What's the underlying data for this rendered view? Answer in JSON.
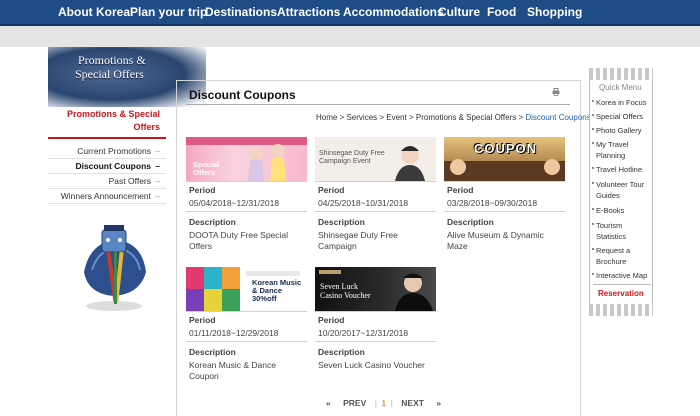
{
  "topnav": {
    "items": [
      "About Korea",
      "Plan your trip",
      "Destinations",
      "Attractions",
      "Accommodations",
      "Culture",
      "Food",
      "Shopping"
    ]
  },
  "sidebar": {
    "banner_line1": "Promotions &",
    "banner_line2": "Special Offers",
    "title": "Promotions & Special Offers",
    "items": [
      {
        "label": "Current Promotions",
        "marker": "–"
      },
      {
        "label": "Discount Coupons",
        "marker": "–"
      },
      {
        "label": "Past Offers",
        "marker": "–"
      },
      {
        "label": "Winners Announcement",
        "marker": "–"
      }
    ]
  },
  "page": {
    "title": "Discount Coupons",
    "breadcrumb": {
      "home": "Home",
      "services": "Services",
      "event": "Event",
      "promotions": "Promotions & Special Offers",
      "current": "Discount Coupons",
      "sep": " > "
    }
  },
  "coupons": [
    {
      "banner_text": "Special Offers",
      "period_label": "Period",
      "period": "05/04/2018~12/31/2018",
      "desc_label": "Description",
      "description": "DOOTA Duty Free Special Offers"
    },
    {
      "banner_text": "Shinsegae Duty Free Campaign Event",
      "period_label": "Period",
      "period": "04/25/2018~10/31/2018",
      "desc_label": "Description",
      "description": "Shinsegae Duty Free Campaign"
    },
    {
      "banner_text": "COUPON",
      "period_label": "Period",
      "period": "03/28/2018~09/30/2018",
      "desc_label": "Description",
      "description": "Alive Museum & Dynamic Maze"
    },
    {
      "banner_text": "Korean Music & Dance 30%off",
      "period_label": "Period",
      "period": "01/11/2018~12/29/2018",
      "desc_label": "Description",
      "description": "Korean Music & Dance Coupon"
    },
    {
      "banner_text": "Seven Luck Casino Voucher",
      "period_label": "Period",
      "period": "10/20/2017~12/31/2018",
      "desc_label": "Description",
      "description": "Seven Luck Casino Voucher"
    }
  ],
  "pager": {
    "first": "«",
    "prev": "PREV",
    "current": "1",
    "next": "NEXT",
    "last": "»"
  },
  "quickmenu": {
    "title": "Quick Menu",
    "items": [
      "Korea in Focus",
      "Special Offers",
      "Photo Gallery",
      "My Travel Planning",
      "Travel Hotline",
      "Volunteer Tour Guides",
      "E-Books",
      "Tourism Statistics",
      "Request a Brochure",
      "Interactive Map"
    ],
    "reservation": "Reservation"
  },
  "colors": {
    "nav": "#1e4d86",
    "accent": "#c4161c",
    "link": "#1e63a6"
  }
}
